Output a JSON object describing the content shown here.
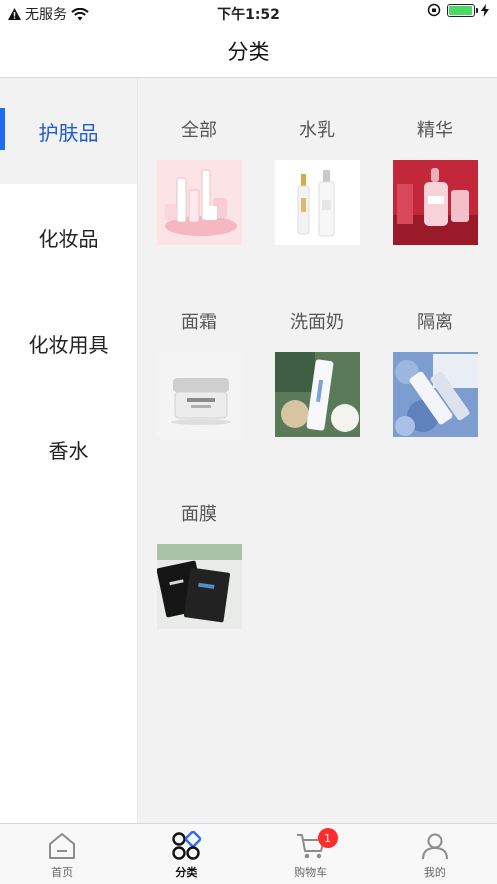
{
  "status_bar": {
    "carrier": "无服务",
    "time": "下午1:52"
  },
  "nav": {
    "title": "分类"
  },
  "sidebar": {
    "items": [
      {
        "label": "护肤品",
        "active": true
      },
      {
        "label": "化妆品",
        "active": false
      },
      {
        "label": "化妆用具",
        "active": false
      },
      {
        "label": "香水",
        "active": false
      }
    ]
  },
  "categories": [
    {
      "label": "全部",
      "image": "skincare-set-image"
    },
    {
      "label": "水乳",
      "image": "toner-lotion-bottles-image"
    },
    {
      "label": "精华",
      "image": "serum-bottle-image"
    },
    {
      "label": "面霜",
      "image": "face-cream-jar-image"
    },
    {
      "label": "洗面奶",
      "image": "cleanser-tube-image"
    },
    {
      "label": "隔离",
      "image": "primer-tube-image"
    },
    {
      "label": "面膜",
      "image": "face-mask-packs-image"
    }
  ],
  "tabbar": {
    "tabs": [
      {
        "label": "首页",
        "icon": "home-icon"
      },
      {
        "label": "分类",
        "icon": "category-icon",
        "active": true
      },
      {
        "label": "购物车",
        "icon": "cart-icon",
        "badge": "1"
      },
      {
        "label": "我的",
        "icon": "profile-icon"
      }
    ]
  },
  "colors": {
    "accent": "#1e6cf0",
    "badge": "#ff2d2d",
    "battery": "#4cd964"
  }
}
